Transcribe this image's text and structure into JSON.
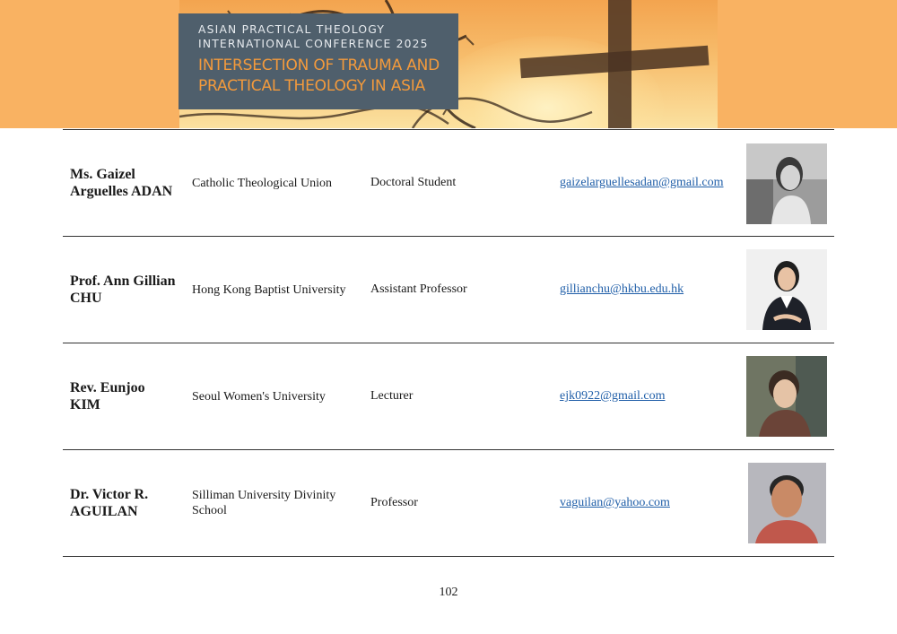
{
  "banner": {
    "line1": "ASIAN PRACTICAL THEOLOGY",
    "line2": "INTERNATIONAL CONFERENCE 2025",
    "title1": "INTERSECTION OF TRAUMA AND",
    "title2": "PRACTICAL THEOLOGY IN ASIA"
  },
  "rows": [
    {
      "name1": "Ms. Gaizel",
      "name2": "Arguelles ADAN",
      "institution": "Catholic Theological Union",
      "position": "Doctoral Student",
      "email": "gaizelarguellesadan@gmail.com"
    },
    {
      "name1": "Prof. Ann Gillian",
      "name2": "CHU",
      "institution": "Hong Kong Baptist University",
      "position": "Assistant Professor",
      "email": "gillianchu@hkbu.edu.hk"
    },
    {
      "name1": "Rev. Eunjoo",
      "name2": "KIM",
      "institution": "Seoul Women's University",
      "position": "Lecturer",
      "email": "ejk0922@gmail.com"
    },
    {
      "name1": "Dr. Victor R.",
      "name2": "AGUILAN",
      "institution": "Silliman University Divinity School",
      "position": "Professor",
      "email": "vaguilan@yahoo.com"
    }
  ],
  "page_number": "102"
}
